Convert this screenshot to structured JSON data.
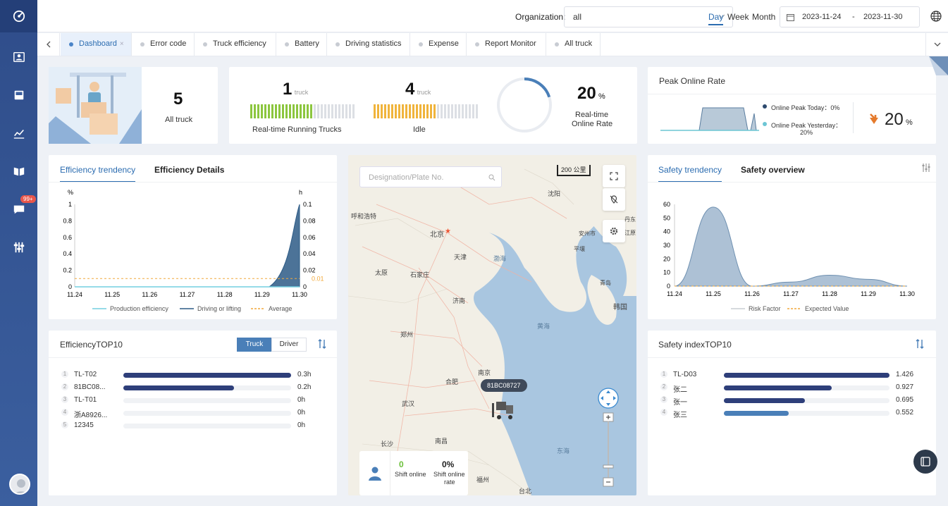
{
  "sidebar": {
    "badge": "99+"
  },
  "topbar": {
    "org_label": "Organization:",
    "org_value": "all",
    "ranges": [
      "Day",
      "Week",
      "Month"
    ],
    "active_range": "Day",
    "date_start": "2023-11-24",
    "date_sep": "-",
    "date_end": "2023-11-30"
  },
  "tabs": [
    "Dashboard",
    "Error code",
    "Truck efficiency",
    "Battery",
    "Driving statistics",
    "Expense",
    "Report Monitor",
    "All truck"
  ],
  "summary": {
    "all_truck": {
      "value": "5",
      "label": "All truck"
    },
    "running": {
      "value": "1",
      "unit": "truck",
      "label": "Real-time Running Trucks",
      "fraction": 0.6
    },
    "idle": {
      "value": "4",
      "unit": "truck",
      "label": "Idle",
      "fraction": 0.6
    },
    "online": {
      "value": "20",
      "unit": "%",
      "label_line1": "Real-time",
      "label_line2": "Online Rate",
      "fraction": 0.2
    }
  },
  "peak": {
    "title": "Peak Online Rate",
    "legend_today": "Online Peak Today：0%",
    "legend_yesterday_line1": "Online Peak Yesterday：",
    "legend_yesterday_line2": "20%",
    "value": "20",
    "unit": "%"
  },
  "efficiency_chart": {
    "tabs": [
      "Efficiency trendency",
      "Efficiency Details"
    ],
    "chart_data": {
      "type": "area",
      "x": [
        "11.24",
        "11.25",
        "11.26",
        "11.27",
        "11.28",
        "11.29",
        "11.30"
      ],
      "ylabel_left": "%",
      "ylabel_right": "h",
      "yticks_left": [
        "1",
        "0.8",
        "0.6",
        "0.4",
        "0.2",
        "0"
      ],
      "yticks_right": [
        "0.1",
        "0.08",
        "0.06",
        "0.04",
        "0.02",
        "0"
      ],
      "ylim_left": [
        0,
        1
      ],
      "ylim_right": [
        0,
        0.1
      ],
      "average_label": "0.01",
      "series": [
        {
          "name": "Production efficiency",
          "values": [
            0,
            0,
            0,
            0,
            0,
            0,
            0
          ]
        },
        {
          "name": "Driving or lifting",
          "values": [
            0,
            0,
            0,
            0,
            0,
            0,
            0.1
          ]
        },
        {
          "name": "Average",
          "values": [
            0.01,
            0.01,
            0.01,
            0.01,
            0.01,
            0.01,
            0.01
          ]
        }
      ]
    }
  },
  "eff_top10": {
    "title": "EfficiencyTOP10",
    "seg": [
      "Truck",
      "Driver"
    ],
    "rows": [
      {
        "idx": "1",
        "name": "TL-T02",
        "value": "0.3h",
        "fraction": 1.0
      },
      {
        "idx": "2",
        "name": "81BC08...",
        "value": "0.2h",
        "fraction": 0.66
      },
      {
        "idx": "3",
        "name": "TL-T01",
        "value": "0h",
        "fraction": 0
      },
      {
        "idx": "4",
        "name": "浙A8926...",
        "value": "0h",
        "fraction": 0
      },
      {
        "idx": "5",
        "name": "12345",
        "value": "0h",
        "fraction": 0
      }
    ]
  },
  "map": {
    "search_placeholder": "Designation/Plate No.",
    "scale": "200 公里",
    "truck_label": "81BC08727",
    "shift_online_value": "0",
    "shift_online_label": "Shift online",
    "shift_rate_value": "0%",
    "shift_rate_label_line1": "Shift online",
    "shift_rate_label_line2": "rate",
    "labels": [
      "呼和浩特",
      "北京",
      "沈阳",
      "天津",
      "太原",
      "石家庄",
      "渤海",
      "济南",
      "郑州",
      "南京",
      "合肥",
      "武汉",
      "长沙",
      "南昌",
      "福州",
      "台北",
      "东海",
      "黄海",
      "韩国",
      "青岛",
      "丹东",
      "安州市",
      "平壤",
      "江原"
    ]
  },
  "safety_chart": {
    "tabs": [
      "Safety trendency",
      "Safety overview"
    ],
    "chart_data": {
      "type": "area",
      "x": [
        "11.24",
        "11.25",
        "11.26",
        "11.27",
        "11.28",
        "11.29",
        "11.30"
      ],
      "yticks": [
        "60",
        "50",
        "40",
        "30",
        "20",
        "10",
        "0"
      ],
      "ylim": [
        0,
        60
      ],
      "series": [
        {
          "name": "Risk Factor",
          "values": [
            0,
            58,
            0,
            3,
            8,
            5,
            0
          ]
        },
        {
          "name": "Expected Value",
          "values": [
            0,
            0,
            0,
            0,
            0,
            0,
            0
          ]
        }
      ]
    }
  },
  "safety_top10": {
    "title": "Safety indexTOP10",
    "rows": [
      {
        "idx": "1",
        "name": "TL-D03",
        "value": "1.426",
        "fraction": 1.0
      },
      {
        "idx": "2",
        "name": "张二",
        "value": "0.927",
        "fraction": 0.65
      },
      {
        "idx": "3",
        "name": "张一",
        "value": "0.695",
        "fraction": 0.49
      },
      {
        "idx": "4",
        "name": "张三",
        "value": "0.552",
        "fraction": 0.39
      }
    ]
  }
}
